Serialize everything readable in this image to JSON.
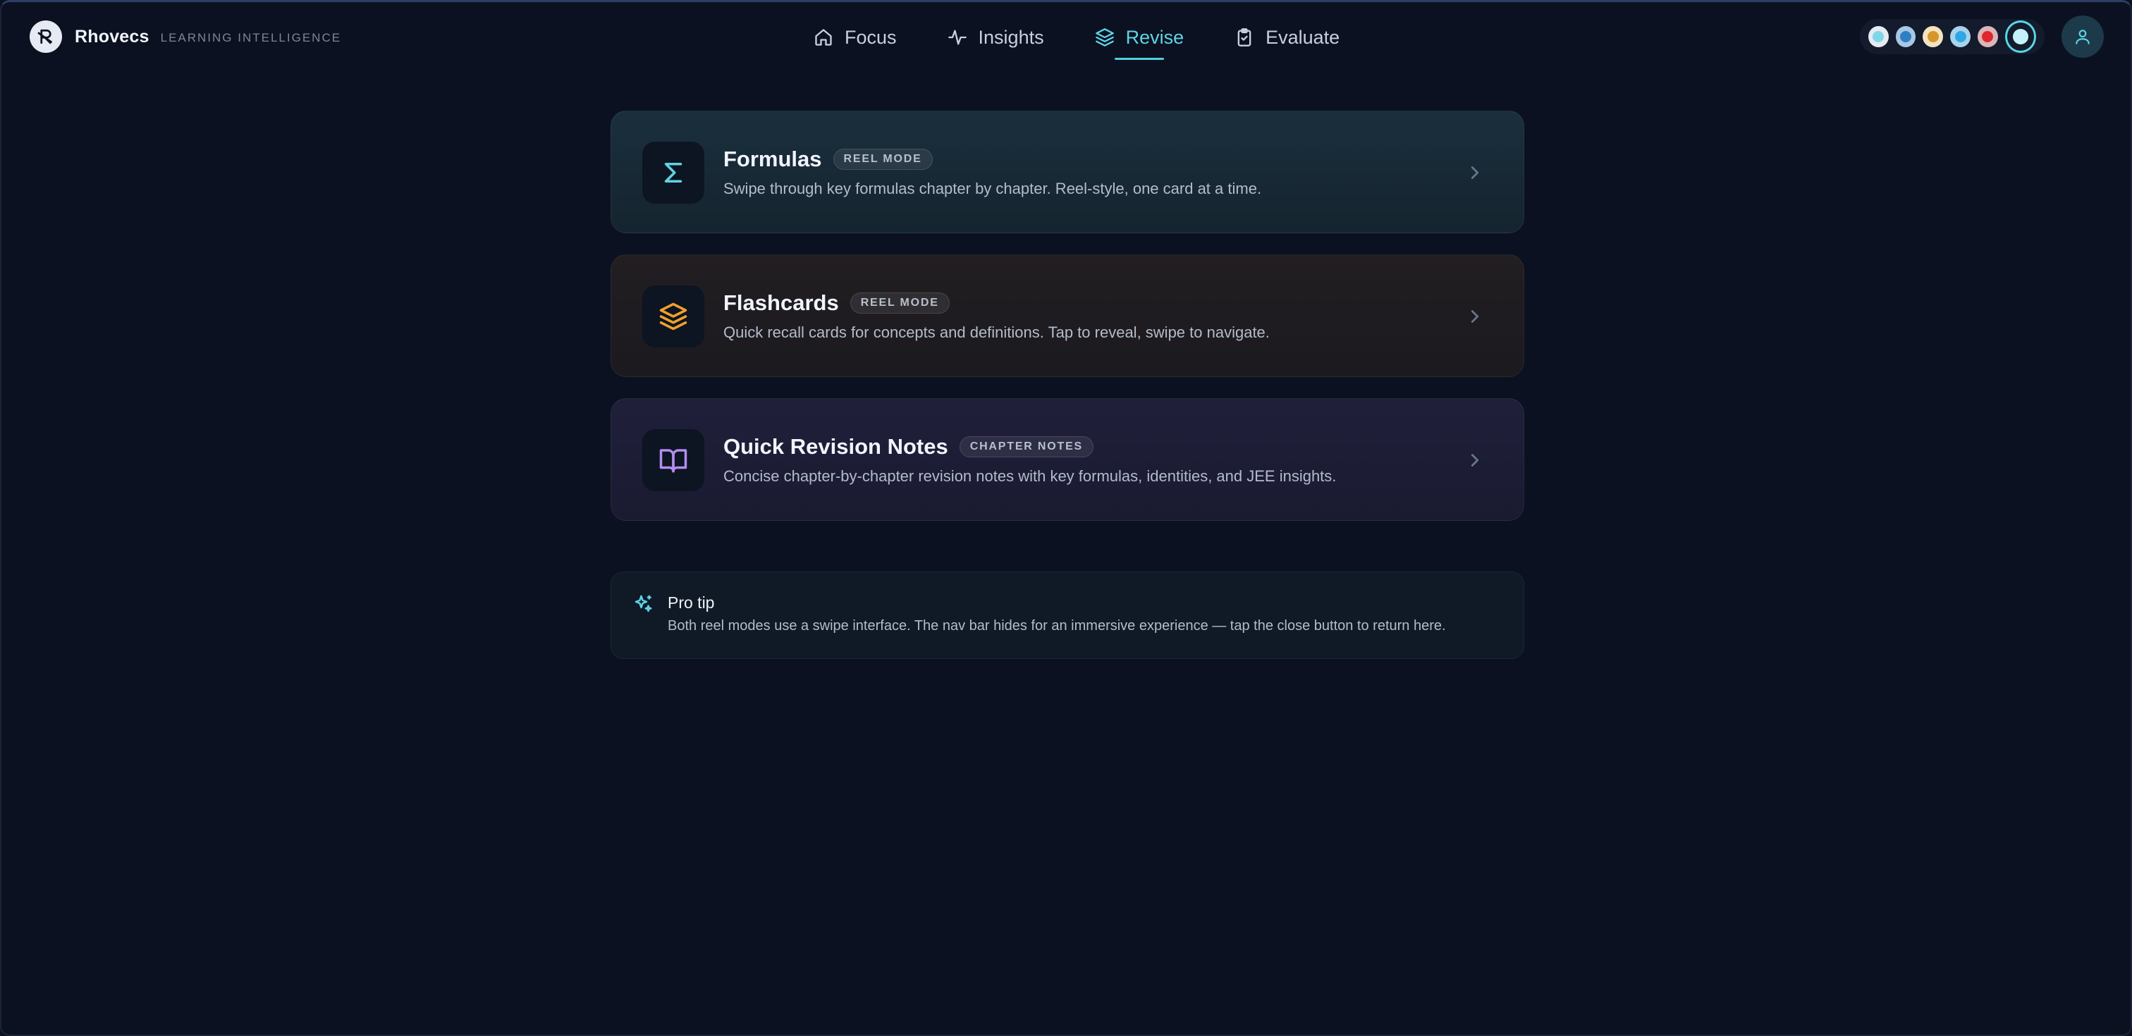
{
  "brand": {
    "name": "Rhovecs",
    "tagline": "LEARNING INTELLIGENCE"
  },
  "nav": {
    "items": [
      {
        "label": "Focus",
        "icon": "home-icon",
        "active": false
      },
      {
        "label": "Insights",
        "icon": "activity-icon",
        "active": false
      },
      {
        "label": "Revise",
        "icon": "layers-icon",
        "active": true
      },
      {
        "label": "Evaluate",
        "icon": "clipboard-check-icon",
        "active": false
      }
    ]
  },
  "theme_dots": [
    {
      "color": "#9be7f2",
      "ring": "#e6eaf2"
    },
    {
      "color": "#3b8fd6",
      "ring": "#a9c7e3"
    },
    {
      "color": "#e8a530",
      "ring": "#f3e3c0"
    },
    {
      "color": "#2ea7e8",
      "ring": "#a9d3ea"
    },
    {
      "color": "#e0262e",
      "ring": "#d9b6b8"
    },
    {
      "color": "#c4f2f8",
      "ring": "#56d6e6",
      "selected": true
    }
  ],
  "cards": [
    {
      "title": "Formulas",
      "badge": "REEL MODE",
      "description": "Swipe through key formulas chapter by chapter. Reel-style, one card at a time.",
      "icon": "sigma-icon",
      "accent": "#5fd4e4"
    },
    {
      "title": "Flashcards",
      "badge": "REEL MODE",
      "description": "Quick recall cards for concepts and definitions. Tap to reveal, swipe to navigate.",
      "icon": "layers-icon",
      "accent": "#f0a02a"
    },
    {
      "title": "Quick Revision Notes",
      "badge": "CHAPTER NOTES",
      "description": "Concise chapter-by-chapter revision notes with key formulas, identities, and JEE insights.",
      "icon": "open-book-icon",
      "accent": "#b48cf0"
    }
  ],
  "tip": {
    "title": "Pro tip",
    "text": "Both reel modes use a swipe interface. The nav bar hides for an immersive experience — tap the close button to return here.",
    "icon": "sparkles-icon"
  },
  "colors": {
    "background": "#0b1120",
    "accent": "#5fd4e4"
  }
}
